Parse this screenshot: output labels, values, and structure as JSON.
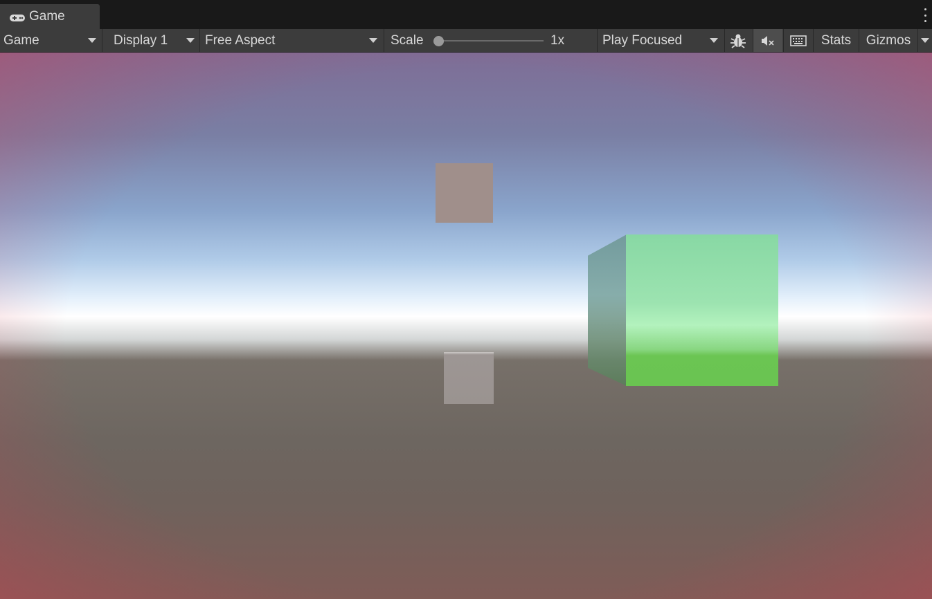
{
  "tab": {
    "title": "Game",
    "icon": "gamepad-icon",
    "menu_icon": "kebab-menu-icon"
  },
  "toolbar": {
    "view_mode": {
      "label": "Game"
    },
    "display": {
      "label": "Display 1"
    },
    "aspect": {
      "label": "Free Aspect"
    },
    "scale": {
      "label": "Scale",
      "value_text": "1x",
      "level": 0
    },
    "play_mode": {
      "label": "Play Focused"
    },
    "bug_icon": "bug-icon",
    "mute_icon": "audio-mute-icon",
    "keyboard_icon": "keyboard-icon",
    "stats_label": "Stats",
    "gizmos_label": "Gizmos"
  },
  "scene": {
    "objects": [
      {
        "name": "floating-cube",
        "color": "#a08f8b"
      },
      {
        "name": "ground-cube",
        "color": "#9a9390"
      },
      {
        "name": "green-cube",
        "color": "#6ac451"
      }
    ]
  },
  "colors": {
    "toolbar_bg": "#3c3c3c",
    "tabbar_bg": "#191919",
    "text": "#d8d8d8"
  }
}
